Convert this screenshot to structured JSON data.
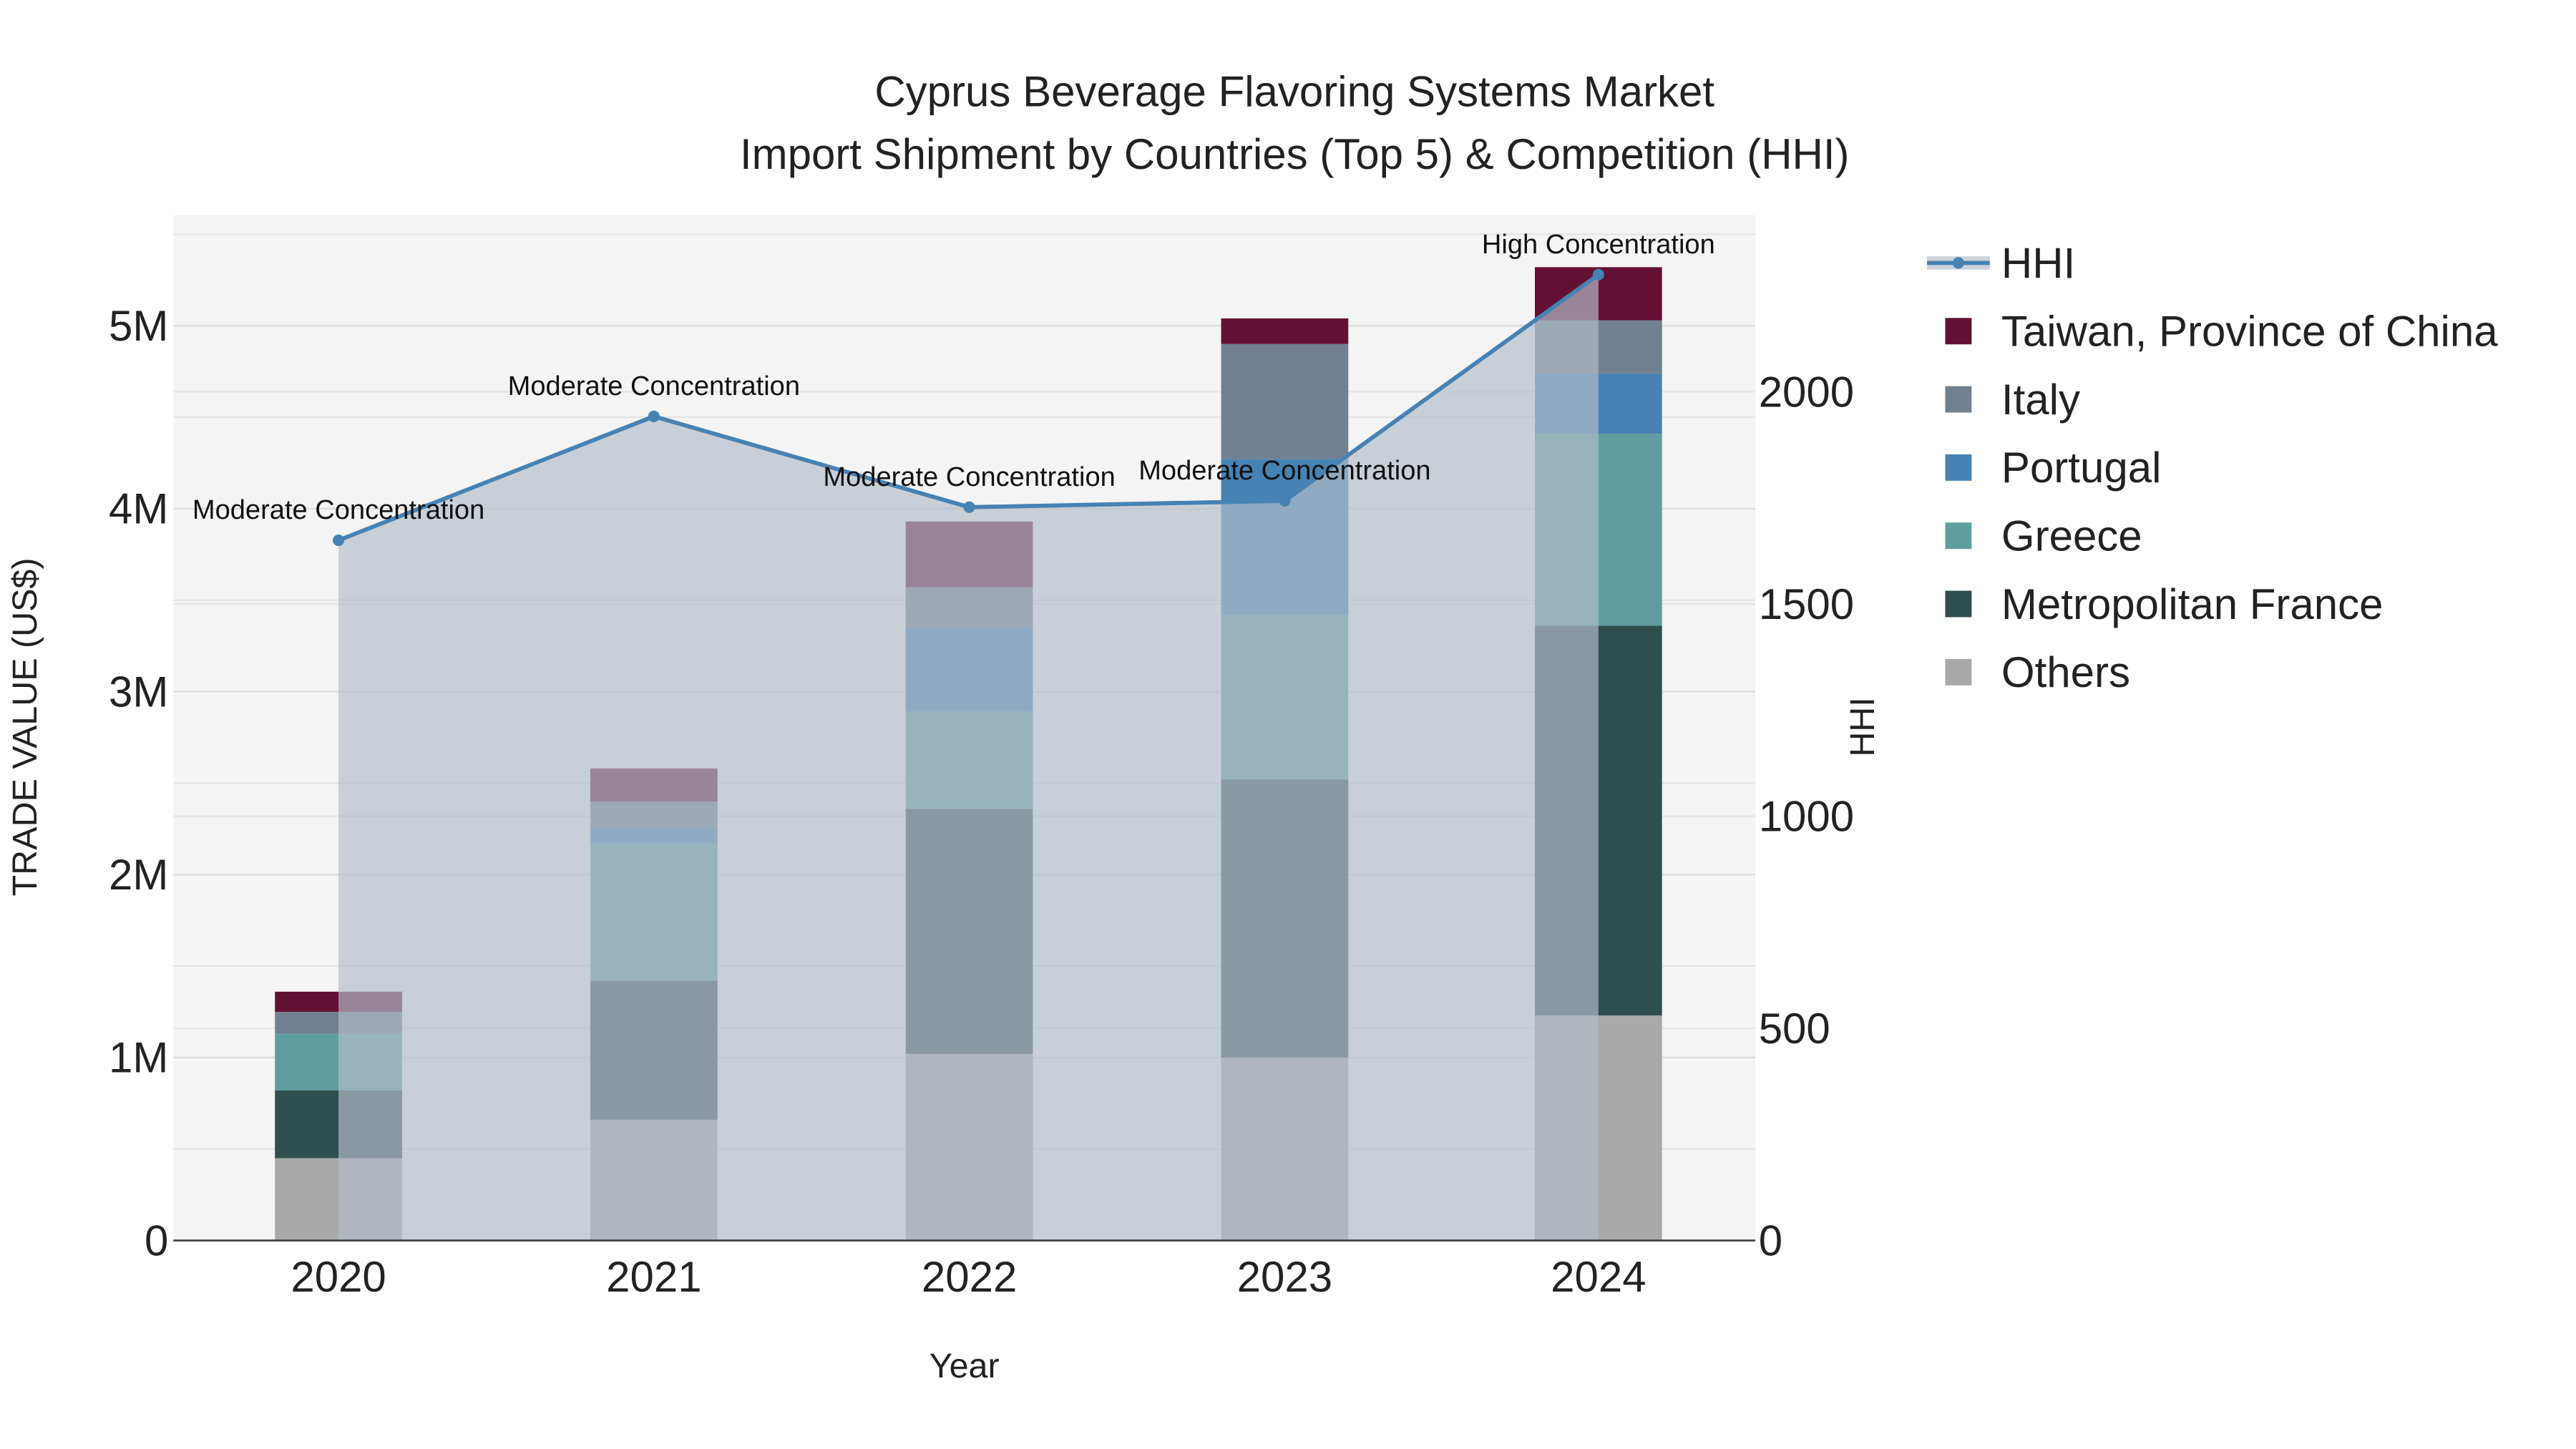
{
  "chart_data": {
    "type": "bar",
    "stacked": true,
    "title": "Cyprus Beverage Flavoring Systems Market",
    "subtitle": "Import Shipment by Countries (Top 5) & Competition (HHI)",
    "xlabel": "Year",
    "ylabel": "TRADE VALUE (US$)",
    "y2label": "HHI",
    "categories": [
      "2020",
      "2021",
      "2022",
      "2023",
      "2024"
    ],
    "ylim": [
      0,
      5600000
    ],
    "y_ticks": [
      0,
      1000000,
      2000000,
      3000000,
      4000000,
      5000000
    ],
    "y_tick_labels": [
      "0",
      "1M",
      "2M",
      "3M",
      "4M",
      "5M"
    ],
    "y2lim": [
      0,
      2410
    ],
    "y2_ticks": [
      0,
      500,
      1000,
      1500,
      2000
    ],
    "y2_tick_labels": [
      "0",
      "500",
      "1000",
      "1500",
      "2000"
    ],
    "grid": true,
    "legend_position": "right",
    "series": [
      {
        "name": "Others",
        "color": "#a9a9a9",
        "values": [
          450000,
          660000,
          1020000,
          1000000,
          1230000
        ]
      },
      {
        "name": "Metropolitan France",
        "color": "#2f4f4f",
        "values": [
          370000,
          760000,
          1340000,
          1520000,
          2130000
        ]
      },
      {
        "name": "Greece",
        "color": "#5f9ea0",
        "values": [
          310000,
          750000,
          530000,
          900000,
          1050000
        ]
      },
      {
        "name": "Portugal",
        "color": "#4682b4",
        "values": [
          0,
          90000,
          460000,
          850000,
          330000
        ]
      },
      {
        "name": "Italy",
        "color": "#708090",
        "values": [
          120000,
          140000,
          220000,
          630000,
          290000
        ]
      },
      {
        "name": "Taiwan, Province of China",
        "color": "#641033",
        "values": [
          110000,
          180000,
          360000,
          140000,
          290000
        ]
      }
    ],
    "hhi": {
      "name": "HHI",
      "color": "#4682b4",
      "values": [
        1650,
        1942,
        1728,
        1743,
        2276
      ],
      "annotations": [
        "Moderate Concentration",
        "Moderate Concentration",
        "Moderate Concentration",
        "Moderate Concentration",
        "High Concentration"
      ]
    },
    "legend_order": [
      "HHI",
      "Taiwan, Province of China",
      "Italy",
      "Portugal",
      "Greece",
      "Metropolitan France",
      "Others"
    ]
  }
}
